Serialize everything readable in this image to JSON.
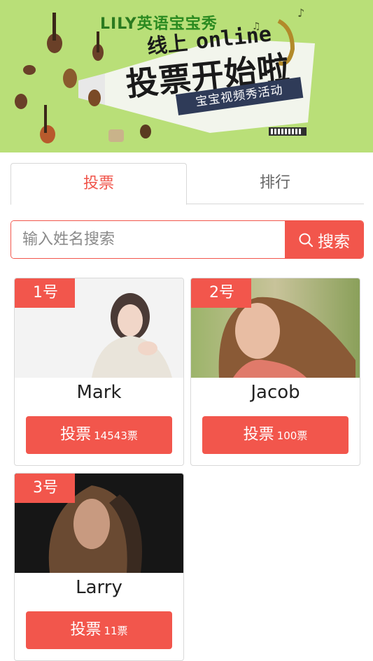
{
  "banner": {
    "brand_latin": "LILY",
    "brand_zh": "英语宝宝秀",
    "line1_zh": "线上",
    "line1_online": "online",
    "headline": "投票开始啦",
    "ribbon": "宝宝视频秀活动"
  },
  "tabs": [
    {
      "label": "投票",
      "active": true
    },
    {
      "label": "排行",
      "active": false
    }
  ],
  "search": {
    "placeholder": "输入姓名搜索",
    "value": "",
    "button_label": "搜索"
  },
  "candidates": [
    {
      "number": "1号",
      "name": "Mark",
      "vote_label": "投票",
      "votes": "14543票"
    },
    {
      "number": "2号",
      "name": "Jacob",
      "vote_label": "投票",
      "votes": "100票"
    },
    {
      "number": "3号",
      "name": "Larry",
      "vote_label": "投票",
      "votes": "11票"
    }
  ],
  "colors": {
    "accent": "#f2564c",
    "banner_bg": "#b9df78"
  }
}
